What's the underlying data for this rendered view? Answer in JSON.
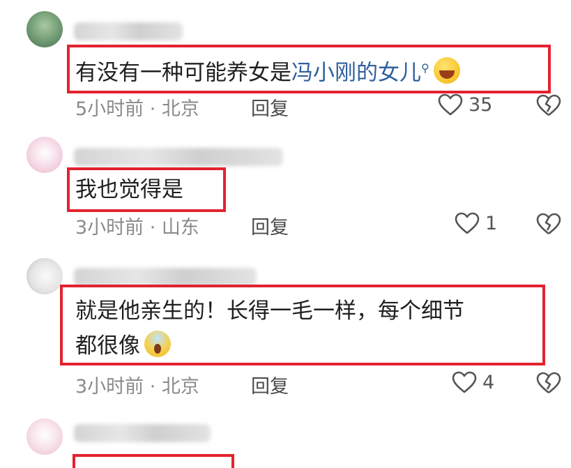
{
  "comments": [
    {
      "text_pre": "有没有一种可能养女是",
      "text_link": "冯小刚的女儿",
      "meta": "5小时前 · 北京",
      "reply": "回复",
      "likes": "35",
      "emoji": "laughing-face-emoji"
    },
    {
      "text": "我也觉得是",
      "meta": "3小时前 · 山东",
      "reply": "回复",
      "likes": "1"
    },
    {
      "line1": "就是他亲生的！长得一毛一样，每个细节",
      "line2": "都很像",
      "meta": "3小时前 · 北京",
      "reply": "回复",
      "likes": "4",
      "emoji": "screaming-face-emoji"
    }
  ],
  "colors": {
    "highlight": "#e2232f",
    "link": "#2f5f9e",
    "meta": "#8a8a8a"
  }
}
